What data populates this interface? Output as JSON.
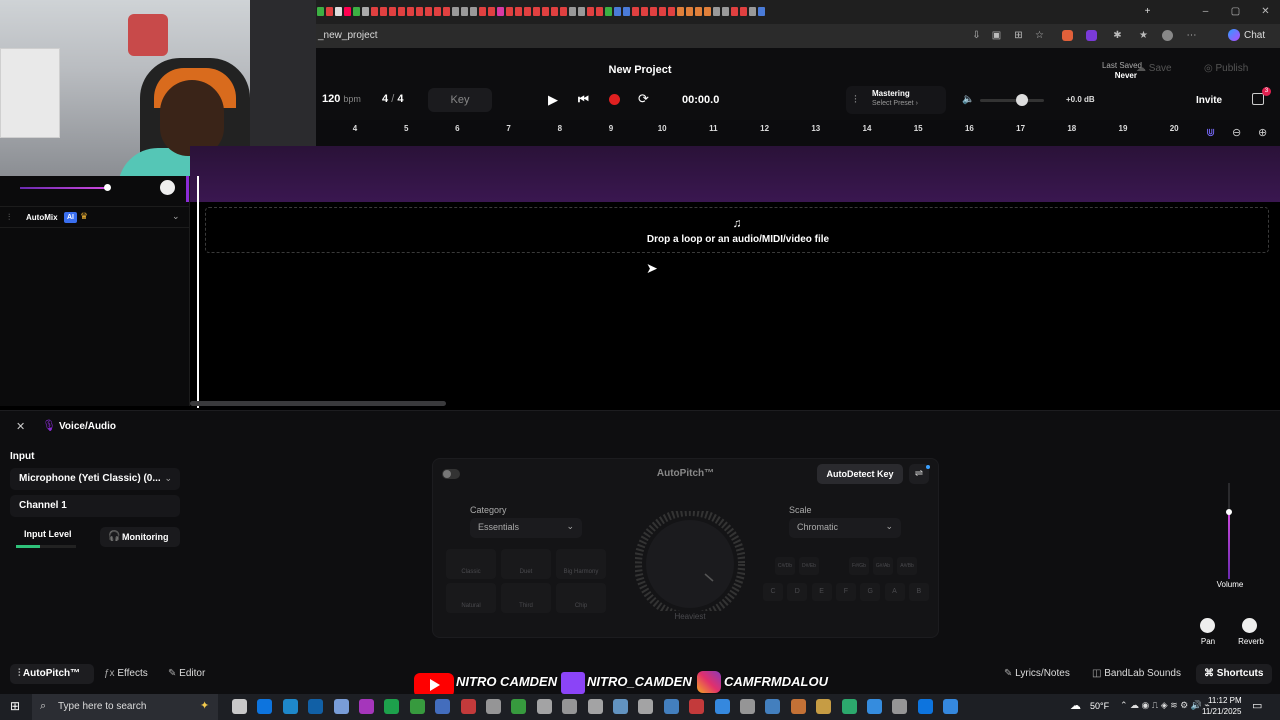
{
  "browser": {
    "url": "_new_project",
    "chat_label": "Chat"
  },
  "header": {
    "title": "New Project",
    "bpm": "120",
    "bpm_unit": "bpm",
    "time_sig_num": "4",
    "time_sig_sep": "/",
    "time_sig_den": "4",
    "key_label": "Key",
    "time": "00:00.0",
    "mastering_title": "Mastering",
    "mastering_preset": "Select Preset ›",
    "volume_db": "+0.0 dB",
    "last_saved_label": "Last Saved",
    "last_saved_value": "Never",
    "save_label": "Save",
    "publish_label": "Publish",
    "invite_label": "Invite",
    "notif_count": "3"
  },
  "ruler": {
    "ticks": [
      "4",
      "5",
      "6",
      "7",
      "8",
      "9",
      "10",
      "11",
      "12",
      "13",
      "14",
      "15",
      "16",
      "17",
      "18",
      "19",
      "20"
    ]
  },
  "track": {
    "automix_label": "AutoMix",
    "ai_badge": "AI"
  },
  "dropzone": {
    "text": "Drop a loop or an audio/MIDI/video file"
  },
  "panel": {
    "title": "Voice/Audio",
    "input_heading": "Input",
    "input_device": "Microphone (Yeti Classic) (0...",
    "channel": "Channel 1",
    "input_level_label": "Input Level",
    "monitoring_label": "Monitoring",
    "volume_label": "Volume",
    "pan_label": "Pan",
    "reverb_label": "Reverb"
  },
  "autopitch": {
    "title": "AutoPitch™",
    "autodetect_label": "AutoDetect Key",
    "category_label": "Category",
    "category_value": "Essentials",
    "scale_label": "Scale",
    "scale_value": "Chromatic",
    "knob_label": "Heaviest",
    "presets": [
      "Classic",
      "Duet",
      "Big Harmony",
      "Natural",
      "Third",
      "Chip"
    ],
    "sharps": [
      "C#/Db",
      "D#/Eb",
      "F#/Gb",
      "G#/Ab",
      "A#/Bb"
    ],
    "notes": [
      "C",
      "D",
      "E",
      "F",
      "G",
      "A",
      "B"
    ]
  },
  "footer": {
    "tabs": [
      "AutoPitch™",
      "Effects",
      "Editor"
    ],
    "lyrics_label": "Lyrics/Notes",
    "sounds_label": "BandLab Sounds",
    "shortcuts_label": "Shortcuts"
  },
  "overlay": {
    "youtube": "NITRO CAMDEN",
    "twitch": "NITRO_CAMDEN",
    "instagram": "CAMFRMDALOU"
  },
  "taskbar": {
    "search_placeholder": "Type here to search",
    "weather": "50°F",
    "time": "11:12 PM",
    "date": "11/21/2025"
  },
  "colors": {
    "accent_purple": "#8b2bd6",
    "record_red": "#e02020",
    "autodetect_bg": "#2a2a2e"
  }
}
